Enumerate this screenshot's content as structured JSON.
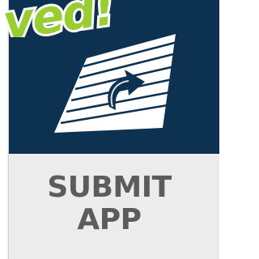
{
  "banner": {
    "text": "ved!",
    "fill_color": "#9acd32",
    "outline_color": "#ffffff",
    "icon": "ribbon-sticker"
  },
  "card": {
    "top_color": "#0d3150",
    "bottom_color": "#ececec",
    "icon": "submit-document-arrow-icon",
    "title_line1": "SUBMIT",
    "title_line2": "APP",
    "title_color": "#5c5c5c"
  }
}
